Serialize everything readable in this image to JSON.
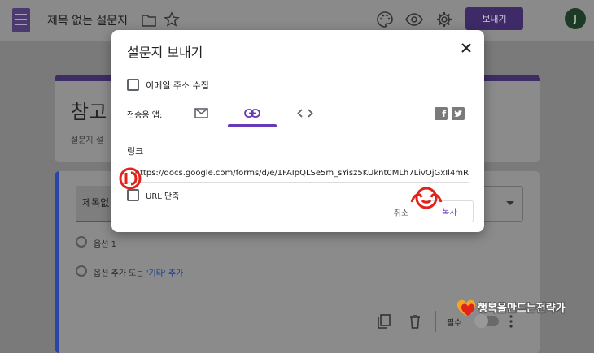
{
  "topbar": {
    "doc_title": "제목 없는 설문지",
    "send_label": "보내기",
    "avatar_initial": "J",
    "accent_color": "#673ab7"
  },
  "form": {
    "title": "참고",
    "description": "설문지 설",
    "question_title": "제목없",
    "options": [
      "옵션 1"
    ],
    "add_option": "옵션 추가",
    "or_text": "또는",
    "add_other": "'기타' 추가",
    "required_label": "필수"
  },
  "dialog": {
    "title": "설문지 보내기",
    "collect_email_label": "이메일 주소 수집",
    "collect_email_checked": false,
    "send_via_label": "전송용 앱:",
    "tabs": [
      {
        "icon": "email-icon",
        "selected": false
      },
      {
        "icon": "link-icon",
        "selected": true
      },
      {
        "icon": "embed-code-icon",
        "selected": false
      }
    ],
    "share_icons": [
      "facebook-icon",
      "twitter-icon"
    ],
    "link_label": "링크",
    "link_url": "https://docs.google.com/forms/d/e/1FAIpQLSe5m_sYisz5KUknt0MLh7LivOjGxIl4mR",
    "shorten_label": "URL 단축",
    "shorten_checked": false,
    "cancel_label": "취소",
    "copy_label": "복사"
  },
  "watermark": {
    "text": "행복을만드는전략가"
  }
}
